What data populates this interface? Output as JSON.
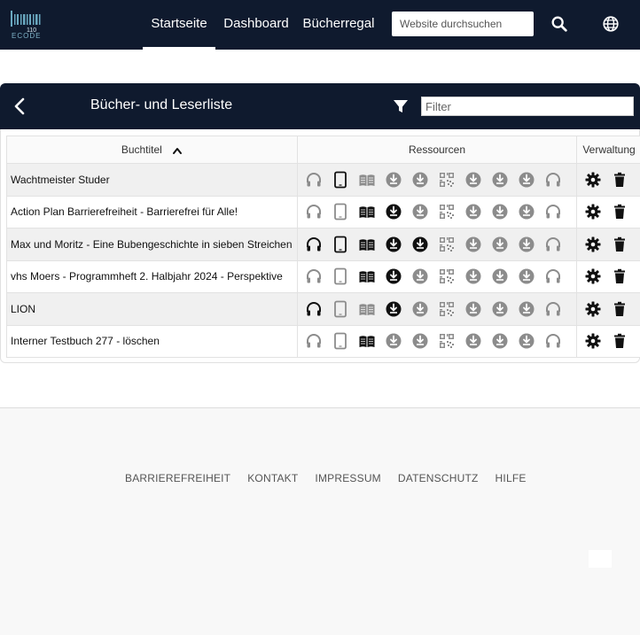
{
  "app": {
    "logo_text": "ECODE",
    "logo_code": "110"
  },
  "nav": {
    "items": [
      {
        "label": "Startseite",
        "active": true
      },
      {
        "label": "Dashboard",
        "active": false
      },
      {
        "label": "Bücherregal",
        "active": false
      }
    ],
    "search_placeholder": "Website durchsuchen",
    "icons": [
      "search-icon",
      "globe-icon"
    ]
  },
  "panel": {
    "title": "Bücher- und Leserliste",
    "filter_placeholder": "Filter"
  },
  "table": {
    "headers": {
      "title": "Buchtitel",
      "resources": "Ressourcen",
      "admin": "Verwaltung"
    },
    "resource_icon_types": [
      "headphones-icon",
      "tablet-icon",
      "book-icon",
      "download-icon",
      "download-icon",
      "qr-code-icon",
      "download-icon",
      "download-icon",
      "download-icon",
      "headphones-icon"
    ],
    "rows": [
      {
        "title": "Wachtmeister Studer",
        "active": [
          0,
          1,
          0,
          0,
          0,
          0,
          0,
          0,
          0,
          0
        ]
      },
      {
        "title": "Action Plan Barrierefreiheit - Barrierefrei für Alle!",
        "active": [
          0,
          0,
          1,
          1,
          0,
          0,
          0,
          0,
          0,
          0
        ]
      },
      {
        "title": "Max und Moritz - Eine Bubengeschichte in sieben Streichen",
        "active": [
          1,
          1,
          1,
          1,
          1,
          0,
          0,
          0,
          0,
          0
        ]
      },
      {
        "title": "vhs Moers - Programmheft 2. Halbjahr 2024 - Perspektive",
        "active": [
          0,
          0,
          1,
          1,
          0,
          0,
          0,
          0,
          0,
          0
        ]
      },
      {
        "title": "LION",
        "active": [
          1,
          0,
          0,
          1,
          0,
          0,
          0,
          0,
          0,
          0
        ]
      },
      {
        "title": "Interner Testbuch 277 - löschen",
        "active": [
          0,
          0,
          1,
          0,
          0,
          0,
          0,
          0,
          0,
          0
        ]
      }
    ],
    "admin_icons": [
      "gear-icon",
      "trash-icon"
    ]
  },
  "colors": {
    "nav_bg": "#0f1a2e",
    "icon_active": "#111111",
    "icon_inactive": "#8c8c8c"
  },
  "footer": {
    "links": [
      "BARRIEREFREIHEIT",
      "KONTAKT",
      "IMPRESSUM",
      "DATENSCHUTZ",
      "HILFE"
    ]
  }
}
